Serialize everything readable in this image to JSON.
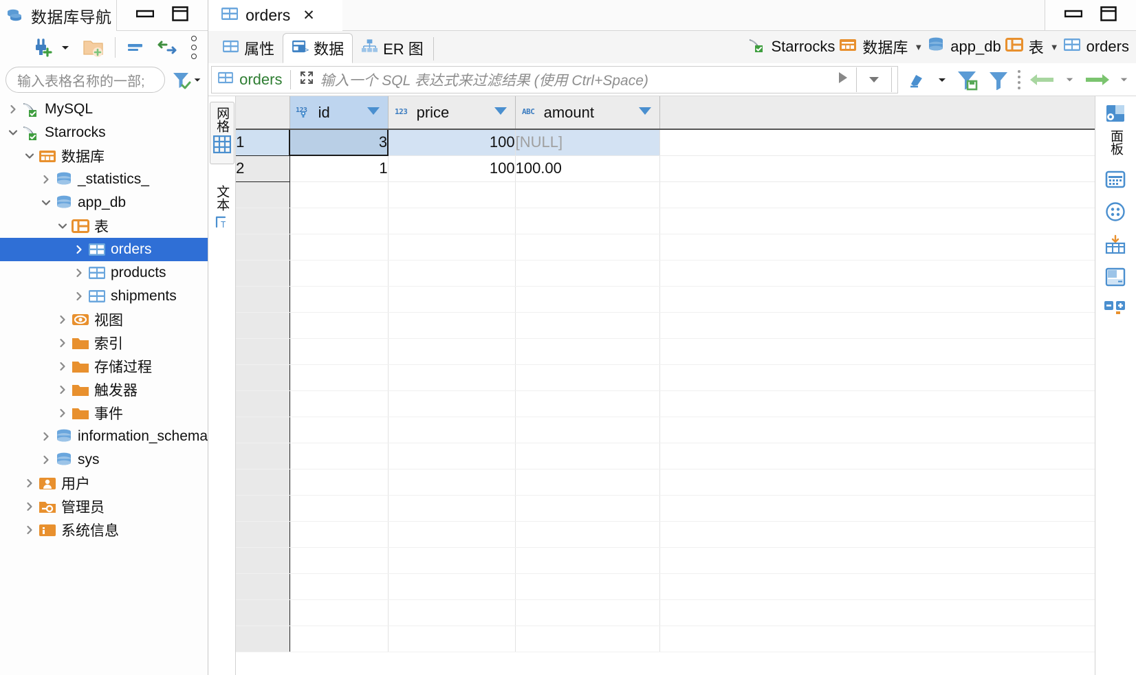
{
  "navigator": {
    "title": "数据库导航",
    "title_icon": "database-stack-icon",
    "close_label": "✕",
    "search_placeholder": "输入表格名称的一部;",
    "toolbar": {
      "new_connection": "新建连接",
      "new_folder": "新建文件夹",
      "collapse_all": "全部折叠",
      "sync": "与编辑器同步",
      "menu": "视图菜单"
    },
    "tree": [
      {
        "label": "MySQL",
        "icon": "mysql-dolphin-icon",
        "indent": 0,
        "twisty": "right",
        "selected": false
      },
      {
        "label": "Starrocks",
        "icon": "mysql-dolphin-icon",
        "indent": 0,
        "twisty": "down",
        "selected": false
      },
      {
        "label": "数据库",
        "icon": "databases-folder-icon",
        "indent": 1,
        "twisty": "down",
        "selected": false
      },
      {
        "label": "_statistics_",
        "icon": "database-icon",
        "indent": 2,
        "twisty": "right",
        "selected": false
      },
      {
        "label": "app_db",
        "icon": "database-icon",
        "indent": 2,
        "twisty": "down",
        "selected": false
      },
      {
        "label": "表",
        "icon": "tables-icon",
        "indent": 3,
        "twisty": "down",
        "selected": false
      },
      {
        "label": "orders",
        "icon": "table-icon",
        "indent": 4,
        "twisty": "right",
        "selected": true
      },
      {
        "label": "products",
        "icon": "table-icon",
        "indent": 4,
        "twisty": "right",
        "selected": false
      },
      {
        "label": "shipments",
        "icon": "table-icon",
        "indent": 4,
        "twisty": "right",
        "selected": false
      },
      {
        "label": "视图",
        "icon": "views-eye-icon",
        "indent": 3,
        "twisty": "right",
        "selected": false
      },
      {
        "label": "索引",
        "icon": "folder-icon",
        "indent": 3,
        "twisty": "right",
        "selected": false
      },
      {
        "label": "存储过程",
        "icon": "folder-icon",
        "indent": 3,
        "twisty": "right",
        "selected": false
      },
      {
        "label": "触发器",
        "icon": "folder-icon",
        "indent": 3,
        "twisty": "right",
        "selected": false
      },
      {
        "label": "事件",
        "icon": "folder-icon",
        "indent": 3,
        "twisty": "right",
        "selected": false
      },
      {
        "label": "information_schema",
        "icon": "database-icon",
        "indent": 2,
        "twisty": "right",
        "selected": false
      },
      {
        "label": "sys",
        "icon": "database-icon",
        "indent": 2,
        "twisty": "right",
        "selected": false
      },
      {
        "label": "用户",
        "icon": "users-icon",
        "indent": 1,
        "twisty": "right",
        "selected": false
      },
      {
        "label": "管理员",
        "icon": "admin-icon",
        "indent": 1,
        "twisty": "right",
        "selected": false
      },
      {
        "label": "系统信息",
        "icon": "sysinfo-icon",
        "indent": 1,
        "twisty": "right",
        "selected": false
      }
    ]
  },
  "window_controls": {
    "minimize": "最小化",
    "maximize": "最大化"
  },
  "editor": {
    "tab": {
      "label": "orders",
      "icon": "table-icon",
      "close": "✕"
    },
    "subtabs": [
      {
        "label": "属性",
        "icon": "properties-icon",
        "active": false
      },
      {
        "label": "数据",
        "icon": "data-icon",
        "active": true
      },
      {
        "label": "ER 图",
        "icon": "er-diagram-icon",
        "active": false
      }
    ],
    "breadcrumb": [
      {
        "label": "Starrocks",
        "icon": "mysql-dolphin-icon",
        "arrow": false
      },
      {
        "label": "数据库",
        "icon": "databases-folder-icon",
        "arrow": true
      },
      {
        "label": "app_db",
        "icon": "database-icon",
        "arrow": false
      },
      {
        "label": "表",
        "icon": "tables-icon",
        "arrow": true
      },
      {
        "label": "orders",
        "icon": "table-icon",
        "arrow": false
      }
    ]
  },
  "filter_bar": {
    "table_name": "orders",
    "placeholder": "输入一个 SQL 表达式来过滤结果 (使用 Ctrl+Space)",
    "expand_icon": "expand-icon",
    "run_icon": "play-icon",
    "dropdown_icon": "chevron-down-icon",
    "buttons": [
      {
        "name": "clear-filter",
        "icon": "eraser-icon"
      },
      {
        "name": "save-filter",
        "icon": "filter-save-icon"
      },
      {
        "name": "filter-settings",
        "icon": "filter-icon"
      },
      {
        "name": "history-back",
        "icon": "arrow-left-icon"
      },
      {
        "name": "history-forward",
        "icon": "arrow-right-icon"
      }
    ]
  },
  "view_tabs": [
    {
      "label": "网格",
      "icon": "grid-icon",
      "active": true
    },
    {
      "label": "文本",
      "icon": "text-icon",
      "active": false
    }
  ],
  "right_rail": {
    "panel_label": "面板",
    "panel_icon": "panel-settings-icon",
    "icons": [
      "calendar-icon",
      "dots-circle-icon",
      "grid-import-icon",
      "split-panel-icon",
      "plus-minus-icon"
    ]
  },
  "grid_data": {
    "columns": [
      {
        "name": "id",
        "type_badge": "123",
        "type": "numeric",
        "key": true,
        "sorted": true,
        "sort_icon": "triangle-down"
      },
      {
        "name": "price",
        "type_badge": "123",
        "type": "numeric",
        "key": false,
        "sorted": false,
        "sort_icon": "triangle-down"
      },
      {
        "name": "amount",
        "type_badge": "ABC",
        "type": "string",
        "key": false,
        "sorted": false,
        "sort_icon": "triangle-down"
      }
    ],
    "rows": [
      {
        "num": "1",
        "id": "3",
        "price": "100",
        "amount": "[NULL]",
        "amount_null": true,
        "selected": true
      },
      {
        "num": "2",
        "id": "1",
        "price": "100",
        "amount": "100.00",
        "amount_null": false,
        "selected": false
      }
    ],
    "empty_row_count": 18,
    "selected_cell": {
      "row": 0,
      "column": "id"
    }
  }
}
